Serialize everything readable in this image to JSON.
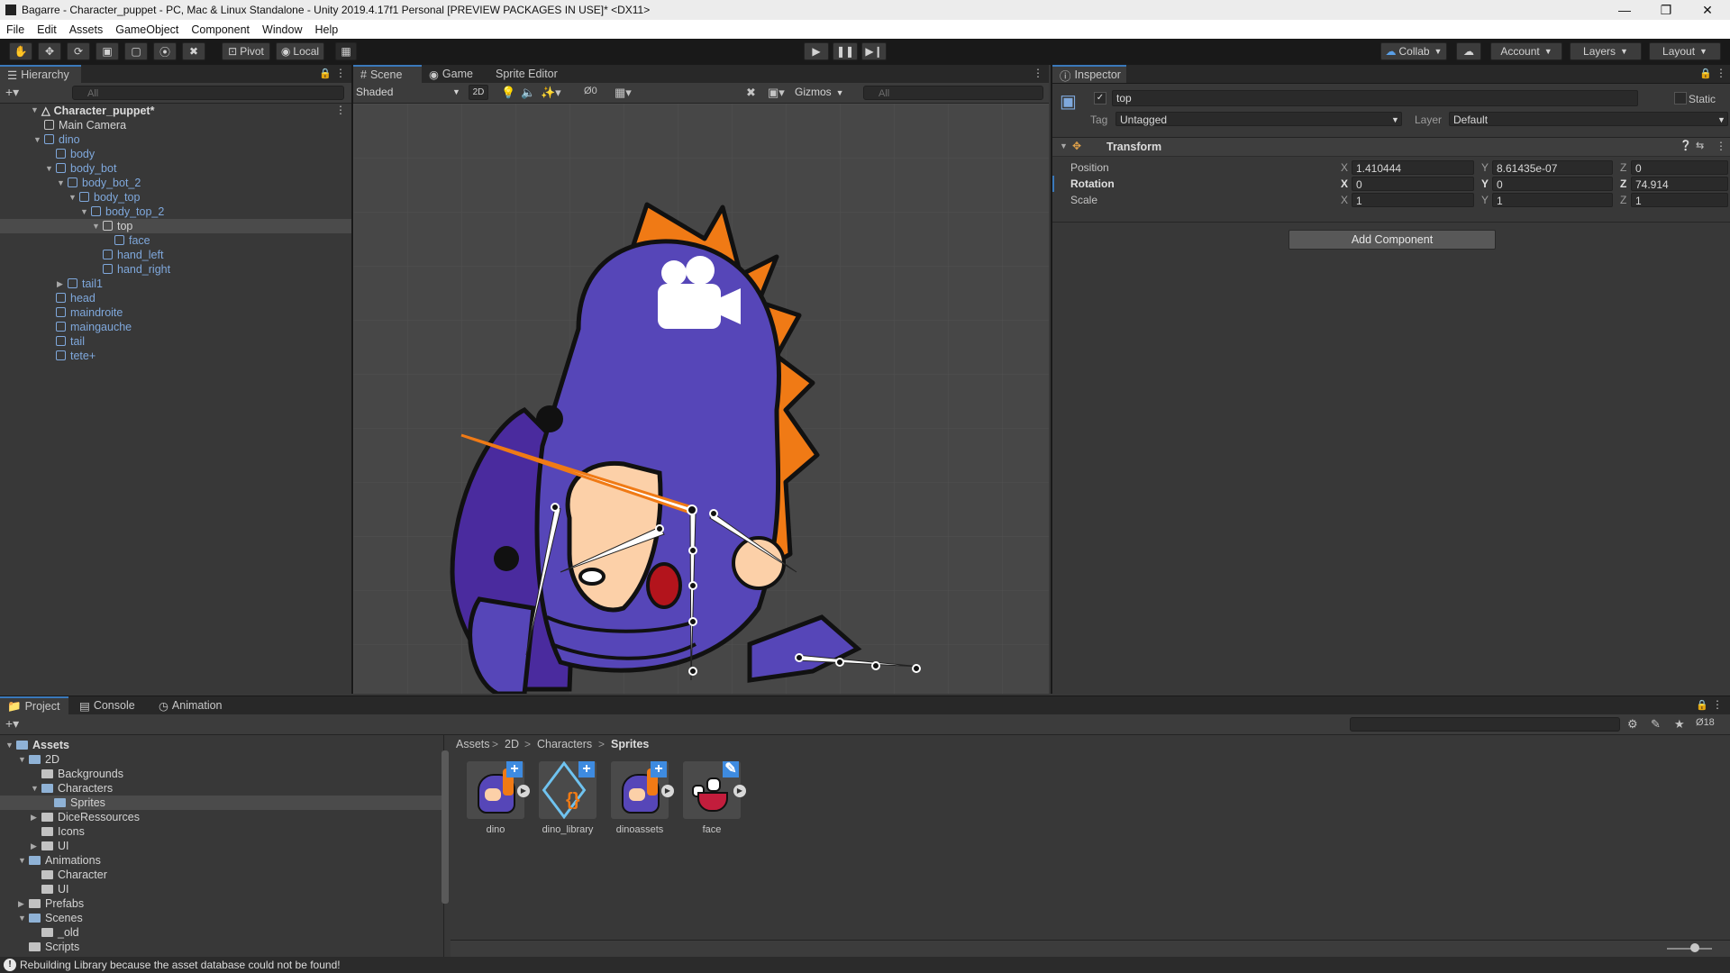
{
  "window": {
    "title": "Bagarre - Character_puppet - PC, Mac & Linux Standalone - Unity 2019.4.17f1 Personal [PREVIEW PACKAGES IN USE]* <DX11>"
  },
  "menu": [
    "File",
    "Edit",
    "Assets",
    "GameObject",
    "Component",
    "Window",
    "Help"
  ],
  "toolbar": {
    "pivot_label": "Pivot",
    "local_label": "Local",
    "collab_label": "Collab",
    "account_label": "Account",
    "layers_label": "Layers",
    "layout_label": "Layout"
  },
  "hierarchy": {
    "tab": "Hierarchy",
    "search_placeholder": "All",
    "scene": "Character_puppet*",
    "items": [
      {
        "label": "Main Camera",
        "depth": 1,
        "arrow": "",
        "blue": false
      },
      {
        "label": "dino",
        "depth": 1,
        "arrow": "open",
        "blue": true
      },
      {
        "label": "body",
        "depth": 2,
        "arrow": "",
        "blue": true
      },
      {
        "label": "body_bot",
        "depth": 2,
        "arrow": "open",
        "blue": true
      },
      {
        "label": "body_bot_2",
        "depth": 3,
        "arrow": "open",
        "blue": true
      },
      {
        "label": "body_top",
        "depth": 4,
        "arrow": "open",
        "blue": true
      },
      {
        "label": "body_top_2",
        "depth": 5,
        "arrow": "open",
        "blue": true
      },
      {
        "label": "top",
        "depth": 6,
        "arrow": "open",
        "blue": false,
        "selected": true
      },
      {
        "label": "face",
        "depth": 7,
        "arrow": "",
        "blue": true
      },
      {
        "label": "hand_left",
        "depth": 6,
        "arrow": "",
        "blue": true
      },
      {
        "label": "hand_right",
        "depth": 6,
        "arrow": "",
        "blue": true
      },
      {
        "label": "tail1",
        "depth": 3,
        "arrow": "closed",
        "blue": true
      },
      {
        "label": "head",
        "depth": 2,
        "arrow": "",
        "blue": true
      },
      {
        "label": "maindroite",
        "depth": 2,
        "arrow": "",
        "blue": true
      },
      {
        "label": "maingauche",
        "depth": 2,
        "arrow": "",
        "blue": true
      },
      {
        "label": "tail",
        "depth": 2,
        "arrow": "",
        "blue": true
      },
      {
        "label": "tete+",
        "depth": 2,
        "arrow": "",
        "blue": true
      }
    ]
  },
  "scene_view": {
    "tabs": [
      "Scene",
      "Game",
      "Sprite Editor"
    ],
    "shading": "Shaded",
    "mode_2d": "2D",
    "hidden_count": "0",
    "gizmos_label": "Gizmos",
    "search_placeholder": "All"
  },
  "inspector": {
    "tab": "Inspector",
    "object_name": "top",
    "static_label": "Static",
    "tag_label": "Tag",
    "tag_value": "Untagged",
    "layer_label": "Layer",
    "layer_value": "Default",
    "component_title": "Transform",
    "rows": [
      {
        "label": "Position",
        "x": "1.410444",
        "y": "8.61435e-07",
        "z": "0"
      },
      {
        "label": "Rotation",
        "x": "0",
        "y": "0",
        "z": "74.914"
      },
      {
        "label": "Scale",
        "x": "1",
        "y": "1",
        "z": "1"
      }
    ],
    "axis_x": "X",
    "axis_y": "Y",
    "axis_z": "Z",
    "add_component": "Add Component"
  },
  "project": {
    "tabs": [
      "Project",
      "Console",
      "Animation"
    ],
    "hidden_count": "18",
    "breadcrumb": [
      "Assets",
      "2D",
      "Characters",
      "Sprites"
    ],
    "tree_root": "Assets",
    "tree": [
      {
        "label": "2D",
        "depth": 1,
        "arrow": "open"
      },
      {
        "label": "Backgrounds",
        "depth": 2,
        "arrow": ""
      },
      {
        "label": "Characters",
        "depth": 2,
        "arrow": "open"
      },
      {
        "label": "Sprites",
        "depth": 3,
        "arrow": "",
        "selected": true
      },
      {
        "label": "DiceRessources",
        "depth": 2,
        "arrow": "closed"
      },
      {
        "label": "Icons",
        "depth": 2,
        "arrow": ""
      },
      {
        "label": "UI",
        "depth": 2,
        "arrow": "closed"
      },
      {
        "label": "Animations",
        "depth": 1,
        "arrow": "open"
      },
      {
        "label": "Character",
        "depth": 2,
        "arrow": ""
      },
      {
        "label": "UI",
        "depth": 2,
        "arrow": ""
      },
      {
        "label": "Prefabs",
        "depth": 1,
        "arrow": "closed"
      },
      {
        "label": "Scenes",
        "depth": 1,
        "arrow": "open"
      },
      {
        "label": "_old",
        "depth": 2,
        "arrow": ""
      },
      {
        "label": "Scripts",
        "depth": 1,
        "arrow": ""
      }
    ],
    "assets": [
      {
        "name": "dino",
        "kind": "sprite"
      },
      {
        "name": "dino_library",
        "kind": "library"
      },
      {
        "name": "dinoassets",
        "kind": "sprite"
      },
      {
        "name": "face",
        "kind": "face"
      }
    ]
  },
  "status": {
    "message": "Rebuilding Library because the asset database could not be found!"
  },
  "colors": {
    "accent": "#3a79bb",
    "selected_row": "#2c5d87",
    "dino_purple": "#5646b8",
    "dino_orange": "#f07a15",
    "skin": "#fcd0a8"
  }
}
